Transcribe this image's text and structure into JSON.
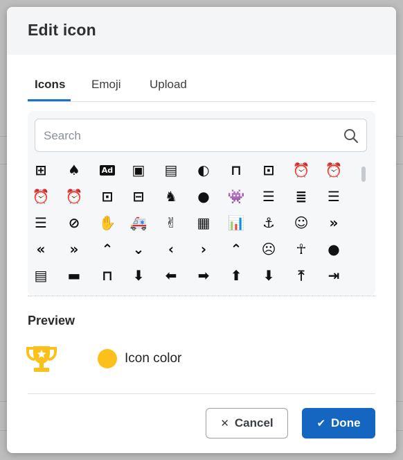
{
  "dialog": {
    "title": "Edit icon"
  },
  "tabs": [
    {
      "label": "Icons",
      "active": true
    },
    {
      "label": "Emoji",
      "active": false
    },
    {
      "label": "Upload",
      "active": false
    }
  ],
  "search": {
    "placeholder": "Search",
    "value": ""
  },
  "icon_grid": [
    [
      "abacus",
      "acorn",
      "ad",
      "address-book",
      "address-card",
      "adjust",
      "air-freshener",
      "alarm-plus",
      "alarm-clock",
      "alarm-exclamation"
    ],
    [
      "alarm-check",
      "alarm-snooze",
      "album",
      "album-collection",
      "alicorn",
      "alien",
      "alien-monster",
      "align-center",
      "align-justify",
      "align-left"
    ],
    [
      "align-right",
      "align-slash",
      "allergies",
      "ambulance",
      "american-sign-language",
      "amp-guitar",
      "analytics",
      "anchor",
      "angel",
      "angle-double-down"
    ],
    [
      "angle-double-left",
      "angle-double-right",
      "angle-double-up",
      "angle-down",
      "angle-left",
      "angle-right",
      "angle-up",
      "angry",
      "ankh",
      "apple-alt"
    ],
    [
      "archive-box-open",
      "archive",
      "archway",
      "arrow-alt-circle-down",
      "arrow-alt-circle-left",
      "arrow-alt-circle-right",
      "arrow-alt-circle-up",
      "arrow-alt-down",
      "arrow-alt-from-bottom",
      "arrow-alt-from-left"
    ]
  ],
  "preview": {
    "heading": "Preview",
    "icon": "trophy-icon",
    "icon_color": "#fbc11a",
    "color_label": "Icon color"
  },
  "footer": {
    "cancel_label": "Cancel",
    "done_label": "Done"
  },
  "colors": {
    "accent": "#1466c0",
    "tab_underline": "#1a73c8",
    "preview_yellow": "#fbc11a"
  }
}
